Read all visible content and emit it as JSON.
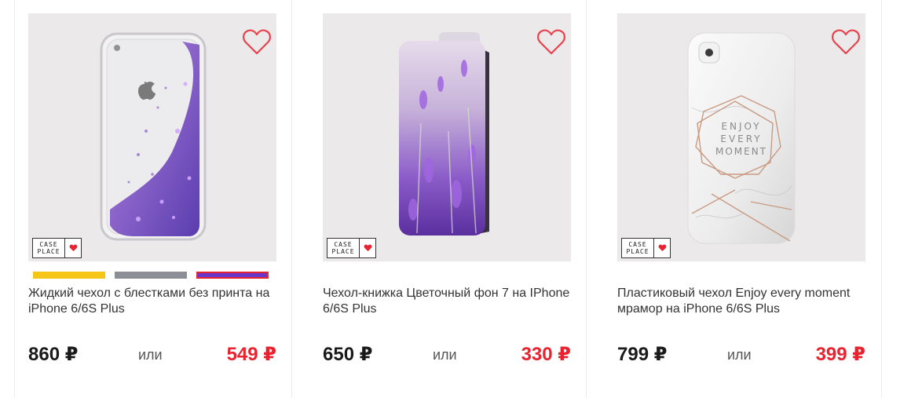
{
  "products": [
    {
      "title": "Жидкий чехол с блестками без принта на iPhone 6/6S Plus",
      "old_price": "860 ₽",
      "or_label": "или",
      "new_price": "549 ₽",
      "logo_line1": "CASE",
      "logo_line2": "PLACE",
      "favorite_icon": "heart-outline-icon",
      "color_swatches": [
        "#f5c518",
        "#8c8f96",
        "#6a35c9"
      ]
    },
    {
      "title": "Чехол-книжка Цветочный фон 7 на IPhone 6/6S Plus",
      "old_price": "650 ₽",
      "or_label": "или",
      "new_price": "330 ₽",
      "logo_line1": "CASE",
      "logo_line2": "PLACE",
      "favorite_icon": "heart-outline-icon"
    },
    {
      "title": "Пластиковый чехол Enjoy every moment мрамор на iPhone 6/6S Plus",
      "old_price": "799 ₽",
      "or_label": "или",
      "new_price": "399 ₽",
      "logo_line1": "CASE",
      "logo_line2": "PLACE",
      "favorite_icon": "heart-outline-icon",
      "print_line1": "ENJOY",
      "print_line2": "EVERY",
      "print_line3": "MOMENT"
    }
  ],
  "colors": {
    "accent_red": "#e8232f",
    "heart": "#e8424d",
    "text": "#333333"
  }
}
